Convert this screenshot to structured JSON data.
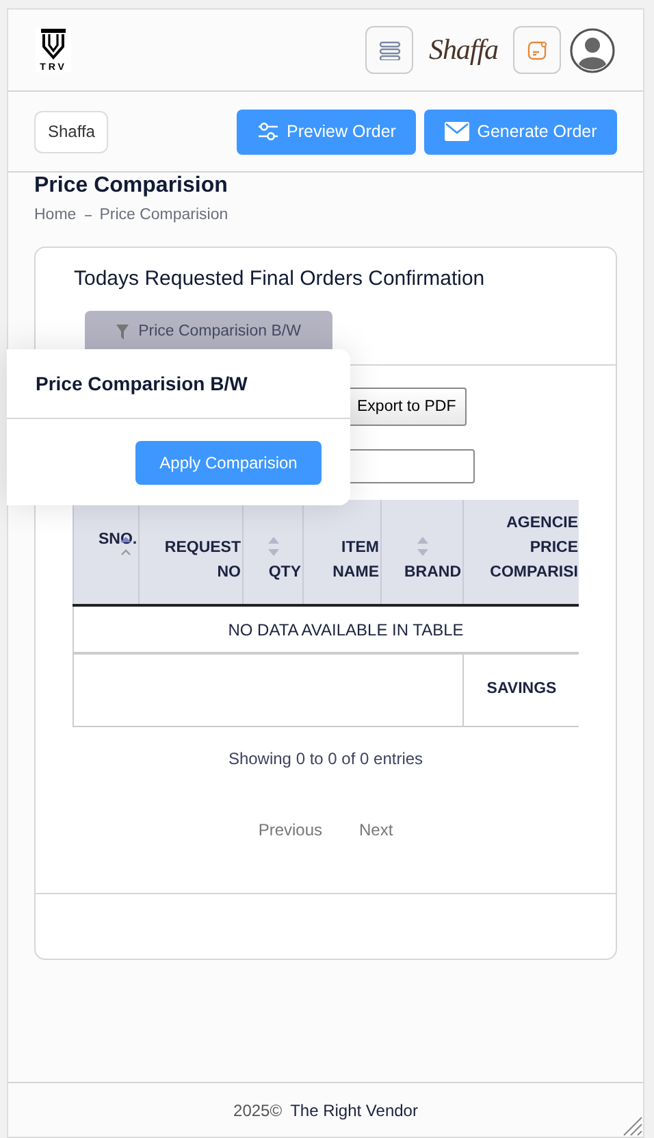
{
  "header": {
    "logo": "TRV",
    "brand": "Shaffa"
  },
  "toolbar": {
    "vendor": "Shaffa",
    "buttons": [
      {
        "label": "Preview Order",
        "kind": "sliders"
      },
      {
        "label": "Generate Order",
        "kind": "mail"
      }
    ]
  },
  "page": {
    "title": "Price Comparision",
    "breadcrumb": [
      "Home",
      "Price Comparision"
    ]
  },
  "card": {
    "title": "Todays Requested Final Orders Confirmation",
    "filter_button": {
      "label": "Price Comparision B/W",
      "disabled": true
    },
    "export_button": "Export to PDF",
    "table": {
      "columns": [
        {
          "label": "SNO.",
          "sorted": true
        },
        {
          "label": "REQUEST NO"
        },
        {
          "label": "QTY",
          "sorted": false
        },
        {
          "label": "ITEM NAME"
        },
        {
          "label": "BRAND",
          "sorted": false
        },
        {
          "label": "AGENCIE PRICE COMPARISI"
        }
      ],
      "empty": "NO DATA AVAILABLE IN TABLE",
      "footer_cell": "SAVINGS"
    },
    "info": "Showing 0 to 0 of 0 entries",
    "pagination": [
      "Previous",
      "Next"
    ]
  },
  "popover": {
    "title": "Price Comparision B/W",
    "button": "Apply Comparision"
  },
  "footer": {
    "year": "2025©",
    "name": "The Right Vendor"
  }
}
